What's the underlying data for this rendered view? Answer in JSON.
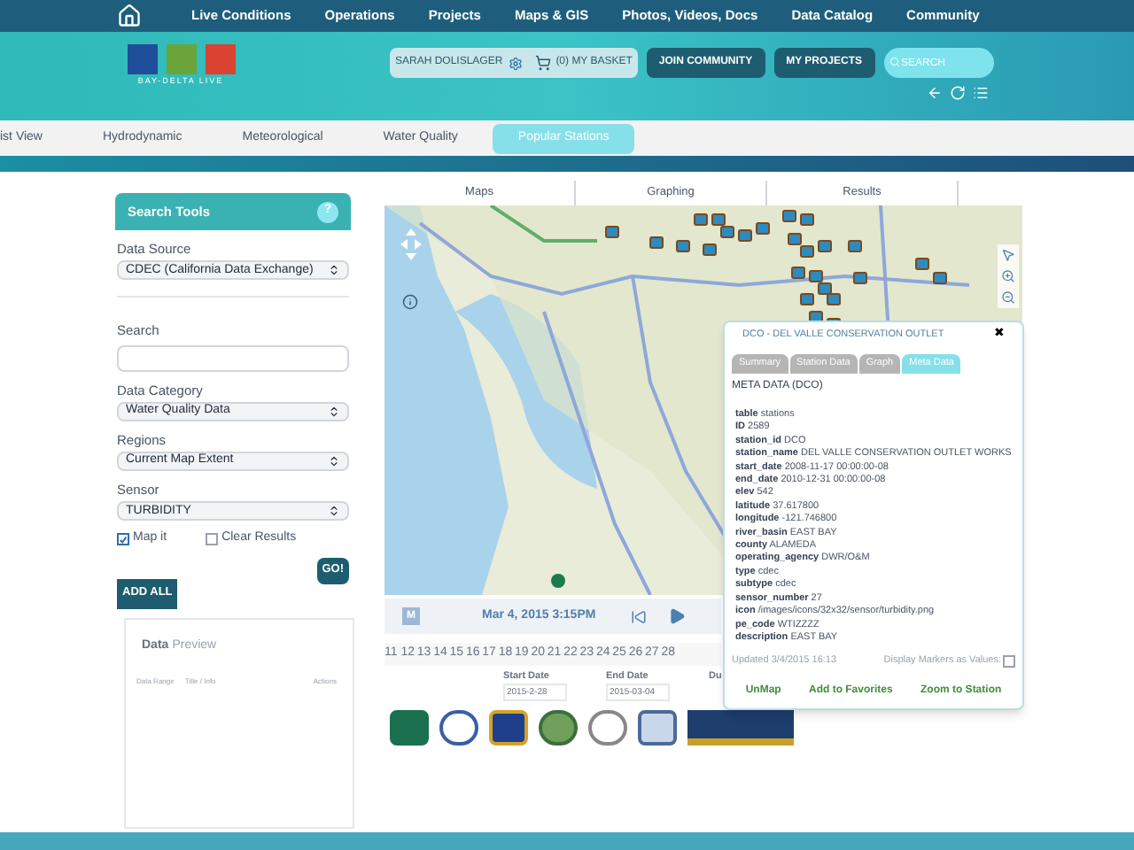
{
  "nav": {
    "items": [
      "Live Conditions",
      "Operations",
      "Projects",
      "Maps & GIS",
      "Photos, Videos, Docs",
      "Data Catalog",
      "Community"
    ]
  },
  "header": {
    "logo_text": "BAY-DELTA LIVE",
    "user": "SARAH DOLISLAGER",
    "basket": "(0) MY BASKET",
    "buttons": [
      "JOIN COMMUNITY",
      "MY PROJECTS"
    ],
    "search": {
      "placeholder": "SEARCH"
    }
  },
  "subtabs": [
    {
      "label": "ist View",
      "selected": false
    },
    {
      "label": "Hydrodynamic",
      "selected": false
    },
    {
      "label": "Meteorological",
      "selected": false
    },
    {
      "label": "Water Quality",
      "selected": false
    },
    {
      "label": "Popular Stations",
      "selected": true
    }
  ],
  "search_tools": {
    "title": "Search Tools",
    "help": "?",
    "fields": [
      {
        "kind": "select",
        "label": "Data Source",
        "value": "CDEC (California Data Exchange)"
      },
      {
        "kind": "input",
        "label": "Search"
      },
      {
        "kind": "select",
        "label": "Data Category",
        "value": "Water Quality Data"
      },
      {
        "kind": "select",
        "label": "Regions",
        "value": "Current Map Extent"
      },
      {
        "kind": "select",
        "label": "Sensor",
        "value": "TURBIDITY"
      }
    ],
    "checkboxes": [
      {
        "label": "Map it",
        "checked": true
      },
      {
        "label": "Clear Results",
        "checked": false
      }
    ],
    "go": "GO!",
    "add_all": "ADD ALL"
  },
  "data_preview": {
    "title_1": "Data",
    "title_2": "Preview",
    "columns": [
      "Data Range",
      "Title / Info",
      "Actions"
    ]
  },
  "main_tabs": [
    "Maps",
    "Graphing",
    "Results"
  ],
  "timeline": {
    "mode": "M",
    "date": "Mar 4, 2015 3:15PM",
    "days": [
      "11",
      "12",
      "13",
      "14",
      "15",
      "16",
      "17",
      "18",
      "19",
      "20",
      "21",
      "22",
      "23",
      "24",
      "25",
      "26",
      "27",
      "28"
    ],
    "start_label": "Start Date",
    "start_value": "2015-2-28",
    "end_label": "End Date",
    "end_value": "2015-03-04",
    "du_label": "Du"
  },
  "popup": {
    "title": "DCO - DEL VALLE CONSERVATION OUTLET",
    "close": "✖",
    "tabs": [
      {
        "label": "Summary",
        "selected": false
      },
      {
        "label": "Station Data",
        "selected": false
      },
      {
        "label": "Graph",
        "selected": false
      },
      {
        "label": "Meta Data",
        "selected": true
      }
    ],
    "heading": "META DATA (DCO)",
    "fields": [
      {
        "key": "table",
        "value": "stations"
      },
      {
        "key": "ID",
        "value": "2589"
      },
      {
        "key": "station_id",
        "value": "DCO"
      },
      {
        "key": "station_name",
        "value": "DEL VALLE CONSERVATION OUTLET WORKS"
      },
      {
        "key": "start_date",
        "value": "2008-11-17 00:00:00-08"
      },
      {
        "key": "end_date",
        "value": "2010-12-31 00:00:00-08"
      },
      {
        "key": "elev",
        "value": "542"
      },
      {
        "key": "latitude",
        "value": "37.617800"
      },
      {
        "key": "longitude",
        "value": "-121.746800"
      },
      {
        "key": "river_basin",
        "value": "EAST BAY"
      },
      {
        "key": "county",
        "value": "ALAMEDA"
      },
      {
        "key": "operating_agency",
        "value": "DWR/O&M"
      },
      {
        "key": "type",
        "value": "cdec"
      },
      {
        "key": "subtype",
        "value": "cdec"
      },
      {
        "key": "sensor_number",
        "value": "27"
      },
      {
        "key": "icon",
        "value": "/images/icons/32x32/sensor/turbidity.png"
      },
      {
        "key": "pe_code",
        "value": "WTIZZZZ"
      },
      {
        "key": "description",
        "value": "EAST BAY"
      }
    ],
    "updated": "Updated 3/4/2015 16:13",
    "markers_label": "Display Markers as Values:",
    "markers_checked": false,
    "actions": [
      "UnMap",
      "Add to Favorites",
      "Zoom to Station"
    ]
  }
}
